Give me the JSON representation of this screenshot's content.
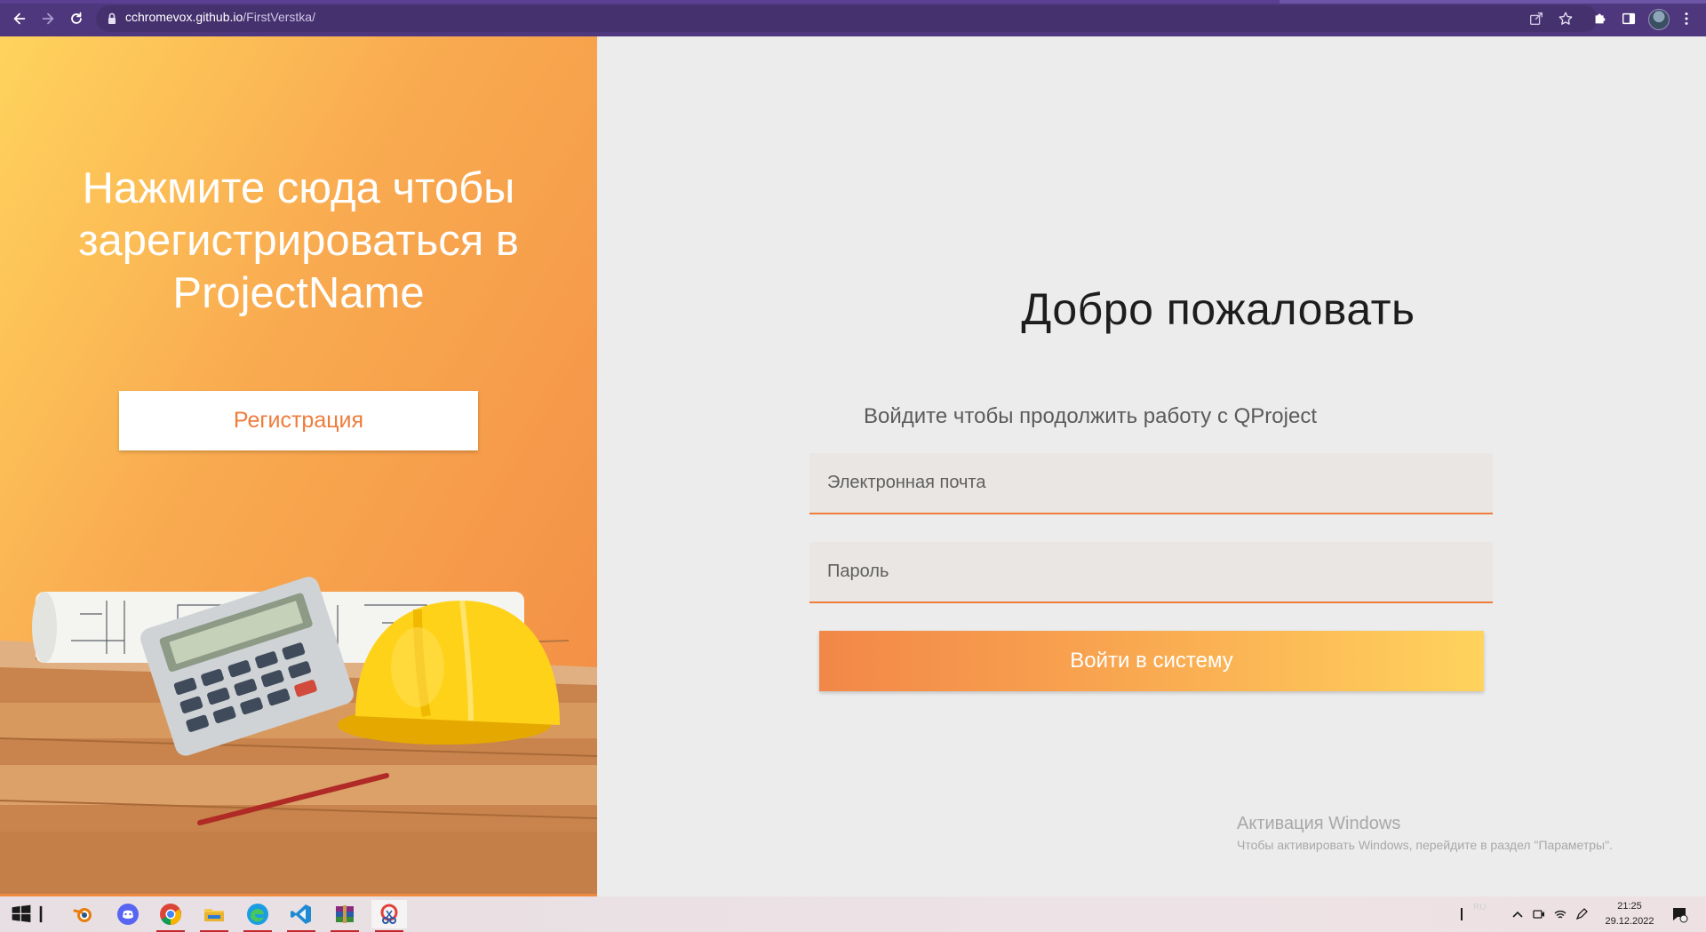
{
  "browser": {
    "url_domain": "cchromevox.github.io",
    "url_path": "/FirstVerstka/"
  },
  "page": {
    "promo_title": "Нажмите сюда чтобы зарегистрироваться в ProjectName",
    "register_label": "Регистрация",
    "welcome_title": "Добро пожаловать",
    "subtitle": "Войдите чтобы продолжить работу с QProject",
    "email_placeholder": "Электронная почта",
    "password_placeholder": "Пароль",
    "login_label": "Войти в систему"
  },
  "watermark": {
    "title": "Активация Windows",
    "text": "Чтобы активировать Windows, перейдите в раздел \"Параметры\"."
  },
  "taskbar": {
    "apps": [
      "windows-start",
      "task-view",
      "blender",
      "discord",
      "chrome",
      "file-explorer",
      "edge",
      "vscode",
      "winrar",
      "snipping-tool"
    ],
    "language": "RU",
    "time": "21:25",
    "date": "29.12.2022"
  },
  "colors": {
    "accent": "#ee7c3b",
    "gradient_start": "#ffd35d",
    "gradient_end": "#f28748",
    "chrome_bg": "#4f377d"
  }
}
